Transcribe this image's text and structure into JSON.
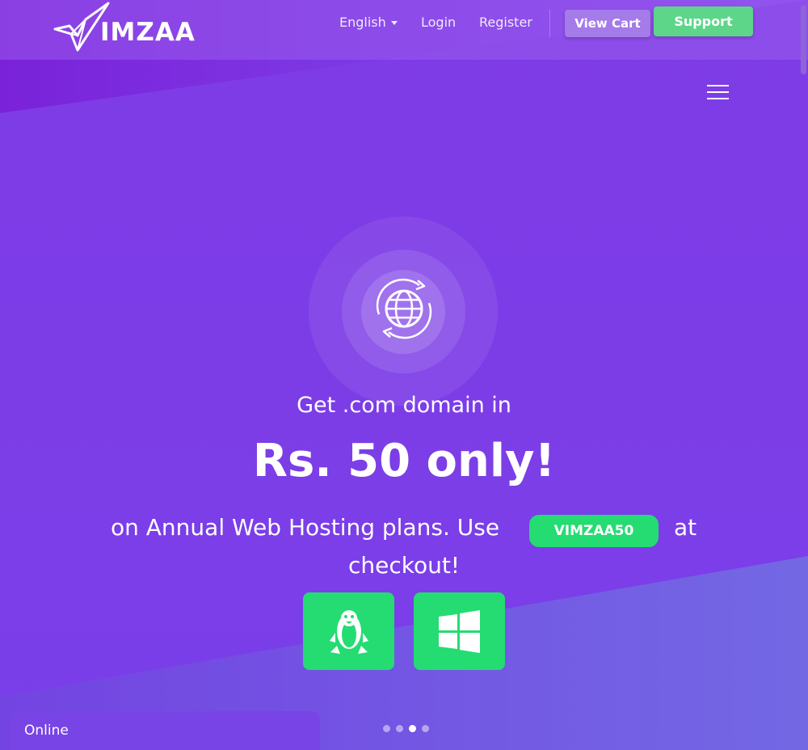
{
  "nav": {
    "logo_text": "IMZAA",
    "language": "English",
    "login": "Login",
    "register": "Register",
    "view_cart": "View Cart",
    "support": "Support"
  },
  "hero": {
    "line1": "Get .com domain in",
    "line2": "Rs. 50 only!",
    "line3": "on Annual Web Hosting plans. Use",
    "promo_code": "VIMZAA50",
    "line3_end": "at",
    "line4": "checkout!"
  },
  "os_options": [
    {
      "icon": "linux-icon"
    },
    {
      "icon": "windows-icon"
    }
  ],
  "carousel": {
    "slide_count": 4,
    "active_slide": 3
  },
  "chat": {
    "status": "Online"
  },
  "colors": {
    "brand_purple": "#7e3be6",
    "accent_green": "#24dc72",
    "support_green": "#5ed68a",
    "cart_purple": "#a57ae9"
  }
}
